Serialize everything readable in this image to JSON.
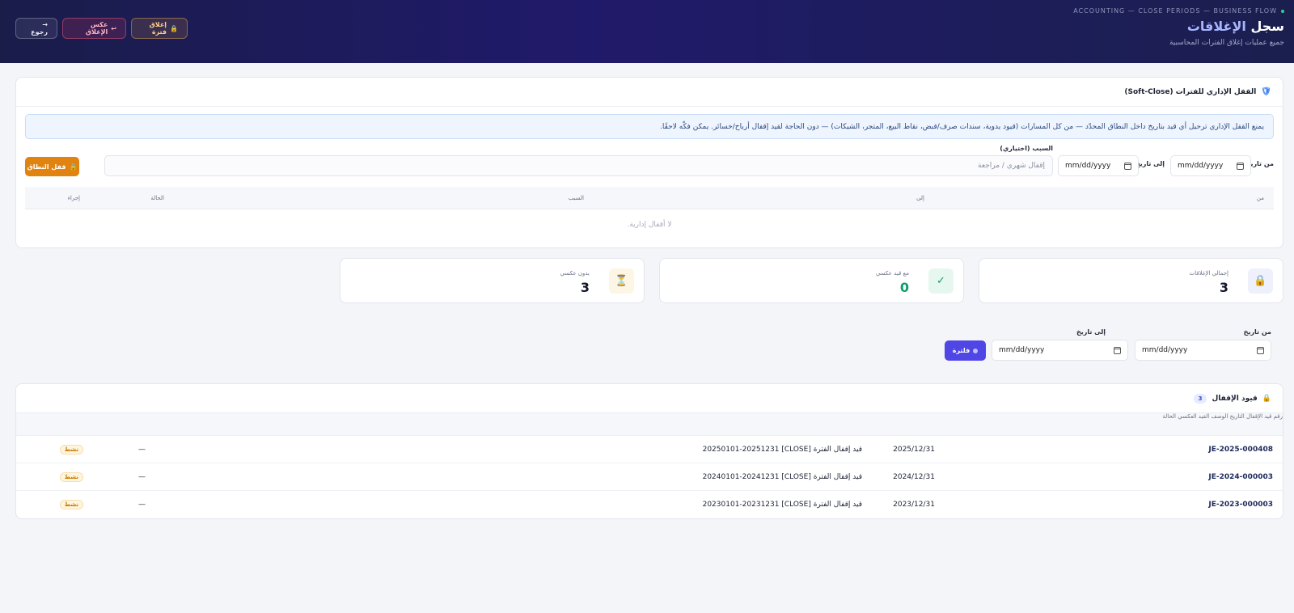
{
  "header": {
    "breadcrumb": "ACCOUNTING — CLOSE PERIODS — BUSINESS FLOW",
    "title_prefix": "سجل ",
    "title_accent": "الإغلاقات",
    "subtitle": "جميع عمليات إغلاق الفترات المحاسبية",
    "buttons": {
      "close_period": "إغلاق فترة",
      "reverse_close": "عكس الإغلاق",
      "back": "→ رجوع"
    }
  },
  "soft_close": {
    "title": "القفل الإداري للفترات (Soft-Close)",
    "notice": "يمنع القفل الإداري ترحيل أي قيد بتاريخ داخل النطاق المحدّد — من كل المسارات (قيود يدوية، سندات صرف/قبض، نقاط البيع، المتجر، الشيكات) — دون الحاجة لقيد إقفال أرباح/خسائر. يمكن فكّه لاحقًا.",
    "from_label": "من تاريخ",
    "to_label": "إلى تاريخ",
    "date_placeholder": "mm/dd/yyyy",
    "reason_label": "السبب (اختياري)",
    "reason_placeholder": "إقفال شهري / مراجعة",
    "lock_button": "قفل النطاق",
    "table_headers": {
      "from": "من",
      "to": "إلى",
      "reason": "السبب",
      "status": "الحالة",
      "action": "إجراء"
    },
    "empty_text": "لا أقفال إدارية."
  },
  "stats": [
    {
      "label": "إجمالي الإغلاقات",
      "value": "3",
      "icon": "lock-icon",
      "color": "#11152a"
    },
    {
      "label": "مع قيد عكسي",
      "value": "0",
      "icon": "check-icon",
      "color": "#0f9d6b"
    },
    {
      "label": "بدون عكسي",
      "value": "3",
      "icon": "hourglass-icon",
      "color": "#11152a"
    }
  ],
  "filter": {
    "from_label": "من تاريخ",
    "to_label": "إلى تاريخ",
    "date_placeholder": "mm/dd/yyyy",
    "filter_button": "فلترة"
  },
  "entries": {
    "title": "قيود الإقفال",
    "count": "3",
    "headers": {
      "ref": "رقم قيد الإقفال",
      "date": "التاريخ",
      "description": "الوصف",
      "reversal": "القيد العكسي",
      "status": "الحالة"
    },
    "rows": [
      {
        "ref": "JE-2025-000408",
        "date": "2025/12/31",
        "description": "قيد إقفال الفترة [CLOSE] 20250101-20251231",
        "reversal": "—",
        "status": "نشط"
      },
      {
        "ref": "JE-2024-000003",
        "date": "2024/12/31",
        "description": "قيد إقفال الفترة [CLOSE] 20240101-20241231",
        "reversal": "—",
        "status": "نشط"
      },
      {
        "ref": "JE-2023-000003",
        "date": "2023/12/31",
        "description": "قيد إقفال الفترة [CLOSE] 20230101-20231231",
        "reversal": "—",
        "status": "نشط"
      }
    ]
  }
}
